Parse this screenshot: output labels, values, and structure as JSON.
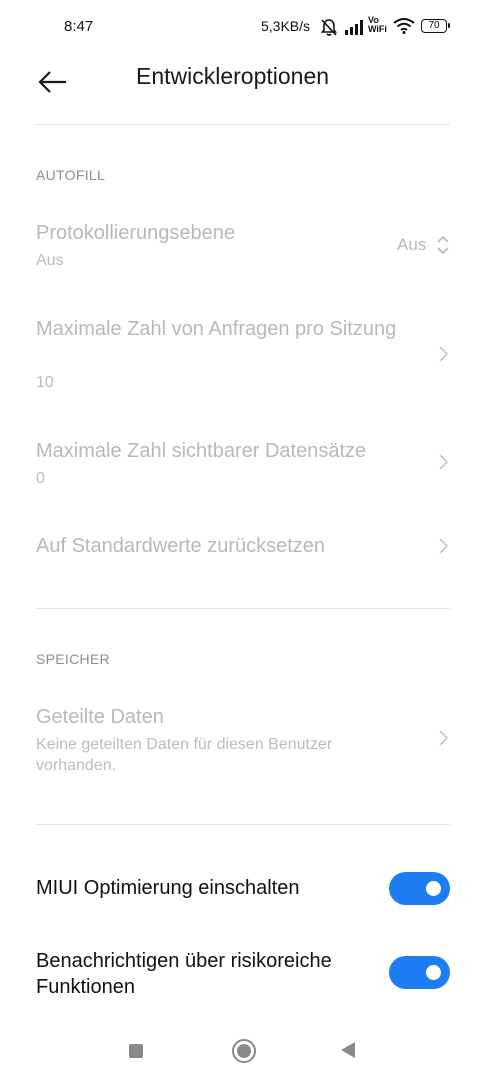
{
  "status_bar": {
    "time": "8:47",
    "net_speed": "5,3KB/s",
    "vowifi_top": "Vo",
    "vowifi_bottom": "WiFi",
    "battery": "70"
  },
  "app_bar": {
    "title": "Entwickleroptionen"
  },
  "autofill": {
    "header": "AUTOFILL",
    "log_level": {
      "title": "Protokollierungsebene",
      "subtitle": "Aus",
      "value": "Aus"
    },
    "max_requests": {
      "title": "Maximale Zahl von Anfragen pro Sitzung",
      "subtitle": "10"
    },
    "max_visible": {
      "title": "Maximale Zahl sichtbarer Datensätze",
      "subtitle": "0"
    },
    "reset": {
      "title": "Auf Standardwerte zurücksetzen"
    }
  },
  "storage": {
    "header": "SPEICHER",
    "shared_data": {
      "title": "Geteilte Daten",
      "subtitle": "Keine geteilten Daten für diesen Benutzer vorhanden."
    }
  },
  "toggles": {
    "miui_optimization": {
      "title": "MIUI Optimierung einschalten",
      "on": true
    },
    "risky_functions": {
      "title": "Benachrichtigen über risikoreiche Funktionen",
      "on": true
    }
  },
  "colors": {
    "accent": "#1e7df2",
    "disabled_text": "#b8b8b8",
    "section_header": "#8c8c9a"
  },
  "icons": [
    "back-arrow-icon",
    "mute-icon",
    "signal-icon",
    "wifi-icon",
    "battery-icon",
    "chevron-right-icon",
    "up-down-icon",
    "nav-recents-icon",
    "nav-home-icon",
    "nav-back-icon"
  ]
}
